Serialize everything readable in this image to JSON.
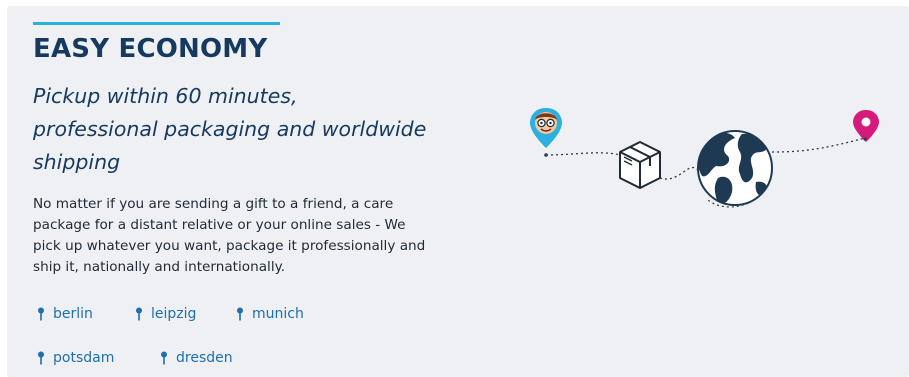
{
  "section": {
    "title": "EASY ECONOMY",
    "subtitle_lines": [
      "Pickup within 60 minutes,",
      "professional packaging and worldwide",
      "shipping"
    ],
    "description_lines": [
      "No matter if you are sending a gift to a friend, a care",
      "package for a distant relative or your online sales - We",
      "pick up whatever you want, package it professionally and",
      "ship it, nationally and internationally."
    ]
  },
  "cities": [
    {
      "label": "berlin"
    },
    {
      "label": "leipzig"
    },
    {
      "label": "munich"
    },
    {
      "label": "potsdam"
    },
    {
      "label": "dresden"
    }
  ],
  "illustration": {
    "icons": [
      "avatar-location-pin-icon",
      "package-box-icon",
      "globe-icon",
      "destination-pin-icon"
    ]
  },
  "colors": {
    "background": "#eef0f4",
    "accent_line": "#2bb0e0",
    "heading": "#163a5f",
    "link": "#1d6fae",
    "origin_pin": "#2bb0e0",
    "destination_pin": "#d6197a"
  }
}
